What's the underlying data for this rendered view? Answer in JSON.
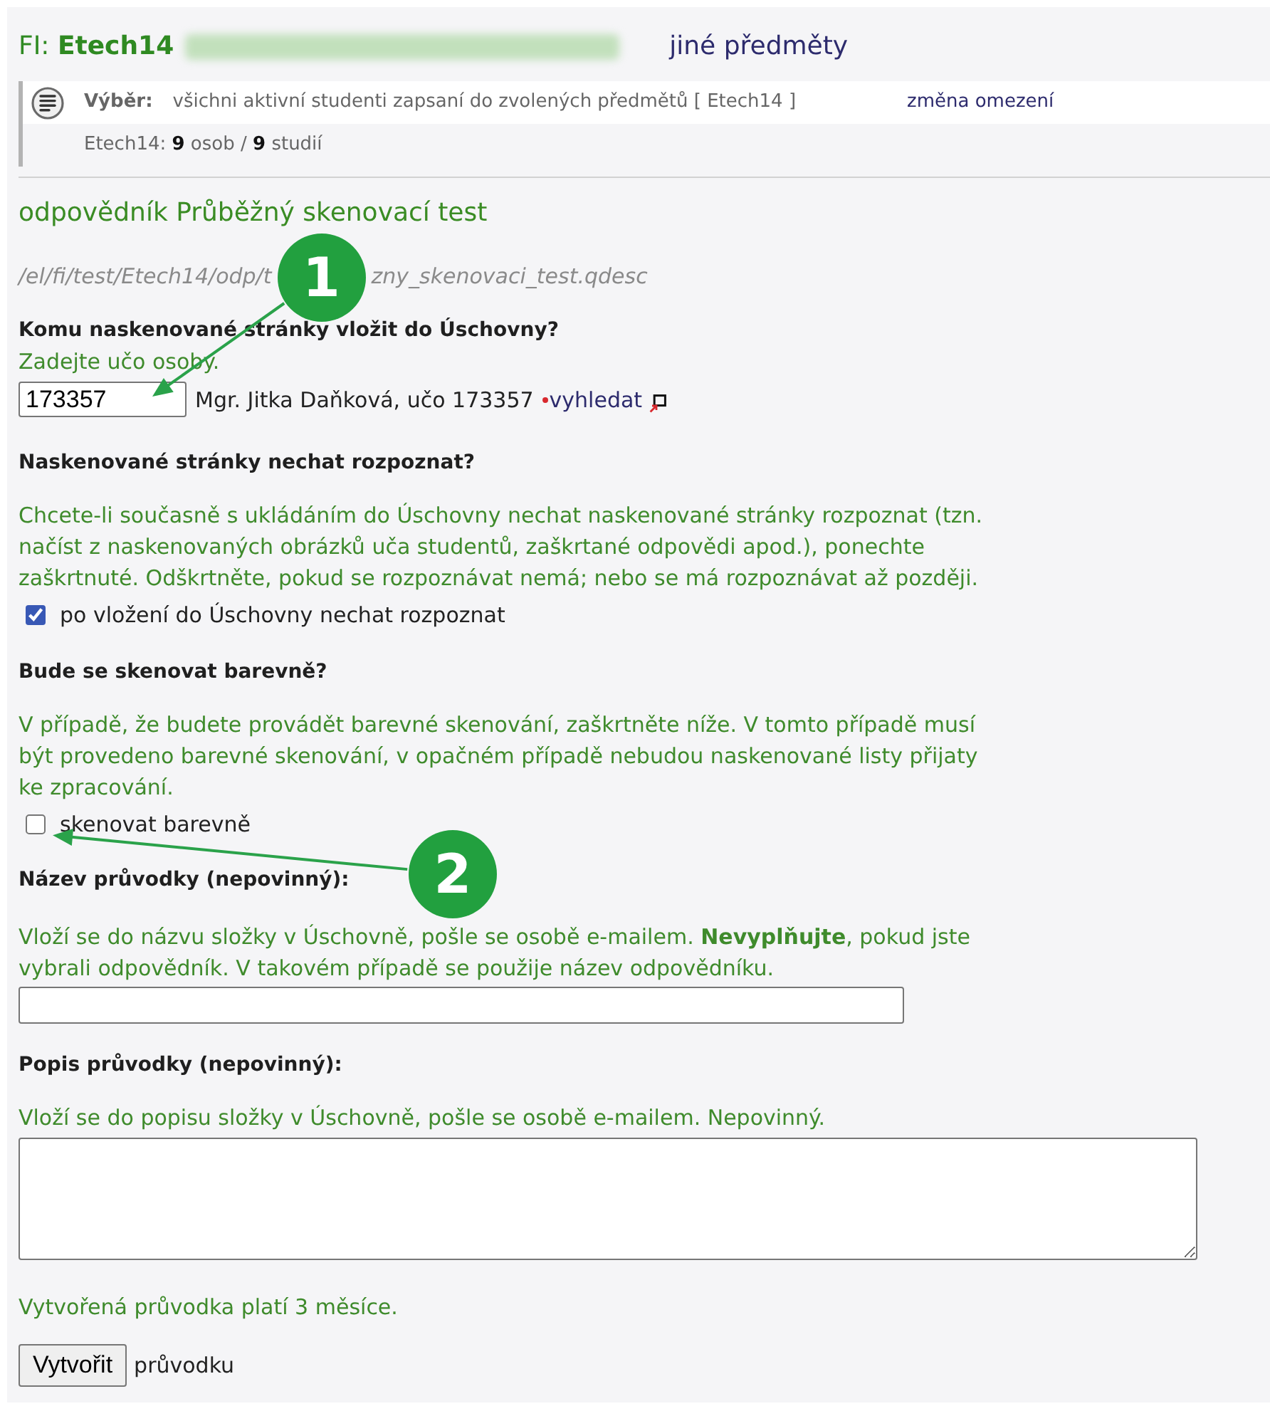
{
  "header": {
    "course_title": "FI: **Etech14**",
    "title_redacted": true,
    "other_courses_link": "jiné předměty"
  },
  "selection": {
    "label": "Výběr:",
    "description": "všichni aktivní studenti zapsaní do zvolených předmětů [ Etech14 ]",
    "change_link": "změna omezení",
    "summary": "Etech14: **9** osob / **9** studií"
  },
  "quiz": {
    "title": "odpovědník Průběžný skenovací test",
    "path_parts": [
      "/el/fi/test/Etech14/odp/t",
      "zny_skenovaci_test.qdesc"
    ]
  },
  "form": [
    {
      "kind": "uco",
      "heading": "Komu naskenované stránky vložit do Úschovny?",
      "hint": "Zadejte učo osoby.",
      "value": "173357",
      "person": "Mgr. Jitka Daňková, učo 173357",
      "link": "vyhledat"
    },
    {
      "kind": "checkbox",
      "heading": "Naskenované stránky nechat rozpoznat?",
      "hint": "Chcete-li současně s ukládáním do Úschovny nechat naskenované stránky rozpoznat (tzn. načíst z naskenovaných obrázků uča studentů, zaškrtané odpovědi apod.), ponechte zaškrtnuté. Odškrtněte, pokud se rozpoznávat nemá; nebo se má rozpoznávat až později.",
      "label": "po vložení do Úschovny nechat rozpoznat",
      "checked": true
    },
    {
      "kind": "checkbox",
      "heading": "Bude se skenovat barevně?",
      "hint": "V případě, že budete provádět barevné skenování, zaškrtněte níže. V tomto případě musí být provedeno barevné skenování, v opačném případě nebudou naskenované listy přijaty ke zpracování.",
      "label": "skenovat barevně",
      "checked": false
    },
    {
      "kind": "input",
      "heading": "Název průvodky (nepovinný):",
      "hint": "Vloží se do názvu složky v Úschovně, pošle se osobě e-mailem. **Nevyplňujte**, pokud jste vybrali odpovědník. V takovém případě se použije název odpovědníku."
    },
    {
      "kind": "textarea",
      "heading": "Popis průvodky (nepovinný):",
      "hint": "Vloží se do popisu složky v Úschovně, pošle se osobě e-mailem. Nepovinný."
    }
  ],
  "note": "Vytvořená průvodka platí 3 měsíce.",
  "submit": {
    "button": "Vytvořit",
    "suffix": "průvodku"
  },
  "callouts": [
    {
      "number": "1"
    },
    {
      "number": "2"
    }
  ]
}
